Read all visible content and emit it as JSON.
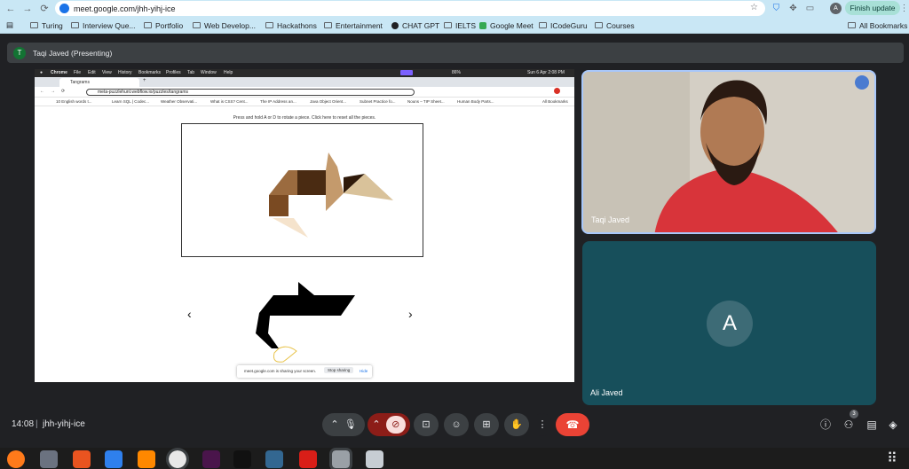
{
  "browser": {
    "url": "meet.google.com/jhh-yihj-ice",
    "finish_update": "Finish update",
    "profile_initial": "A"
  },
  "bookmarks": [
    {
      "label": "Turing",
      "icon": "folder-icon"
    },
    {
      "label": "Interview Que...",
      "icon": "folder-icon"
    },
    {
      "label": "Portfolio",
      "icon": "folder-icon"
    },
    {
      "label": "Web Develop...",
      "icon": "folder-icon"
    },
    {
      "label": "Hackathons",
      "icon": "folder-icon"
    },
    {
      "label": "Entertainment",
      "icon": "folder-icon"
    },
    {
      "label": "CHAT GPT",
      "icon": "chatgpt-icon"
    },
    {
      "label": "IELTS",
      "icon": "folder-icon"
    },
    {
      "label": "Google Meet",
      "icon": "meet-icon"
    },
    {
      "label": "ICodeGuru",
      "icon": "folder-icon"
    },
    {
      "label": "Courses",
      "icon": "folder-icon"
    }
  ],
  "all_bookmarks": "All Bookmarks",
  "meet": {
    "presenter_initial": "T",
    "presenter_label": "Taqi Javed (Presenting)",
    "time": "14:08",
    "separator": "|",
    "meeting_code": "jhh-yihj-ice",
    "participants_count": "3"
  },
  "participants": [
    {
      "name": "Taqi Javed"
    },
    {
      "name": "Ali Javed",
      "initial": "A"
    }
  ],
  "shared_screen": {
    "menubar": [
      "Chrome",
      "File",
      "Edit",
      "View",
      "History",
      "Bookmarks",
      "Profiles",
      "Tab",
      "Window",
      "Help"
    ],
    "menubar_clock": "Sun 6 Apr  2:08 PM",
    "menubar_battery": "86%",
    "tab_title": "Tangrams",
    "url": "meta-puzzlehunt.webflow.io/puzzles/tangrams",
    "bookmarks": [
      "10 English words t...",
      "Learn SQL | Codec...",
      "Weather Observati...",
      "What is CSS? Cent...",
      "The IP Address an...",
      "Java Object Orient...",
      "Subnet Practice fo...",
      "Nouns – TIP Sheet...",
      "Human Body Parts..."
    ],
    "all_bookmarks": "All Bookmarks",
    "hint": "Press and hold A or D to rotate a piece. Click here to reset all the pieces.",
    "share_notice": "meet.google.com is sharing your screen.",
    "stop_sharing": "Stop sharing",
    "hide": "Hide",
    "prev_arrow": "‹",
    "next_arrow": "›"
  },
  "colors": {
    "chrome_bar": "#c9e7f5",
    "meet_bg": "#202124",
    "end_call": "#ea4335",
    "cam_off": "#8c1d18",
    "ali_tile": "#174f5b",
    "tangram_dark": "#4a2b12",
    "tangram_mid": "#7a4a22",
    "tangram_light": "#c49a6c",
    "tangram_tan": "#d9c29a",
    "tangram_peach": "#f5e3cc"
  }
}
